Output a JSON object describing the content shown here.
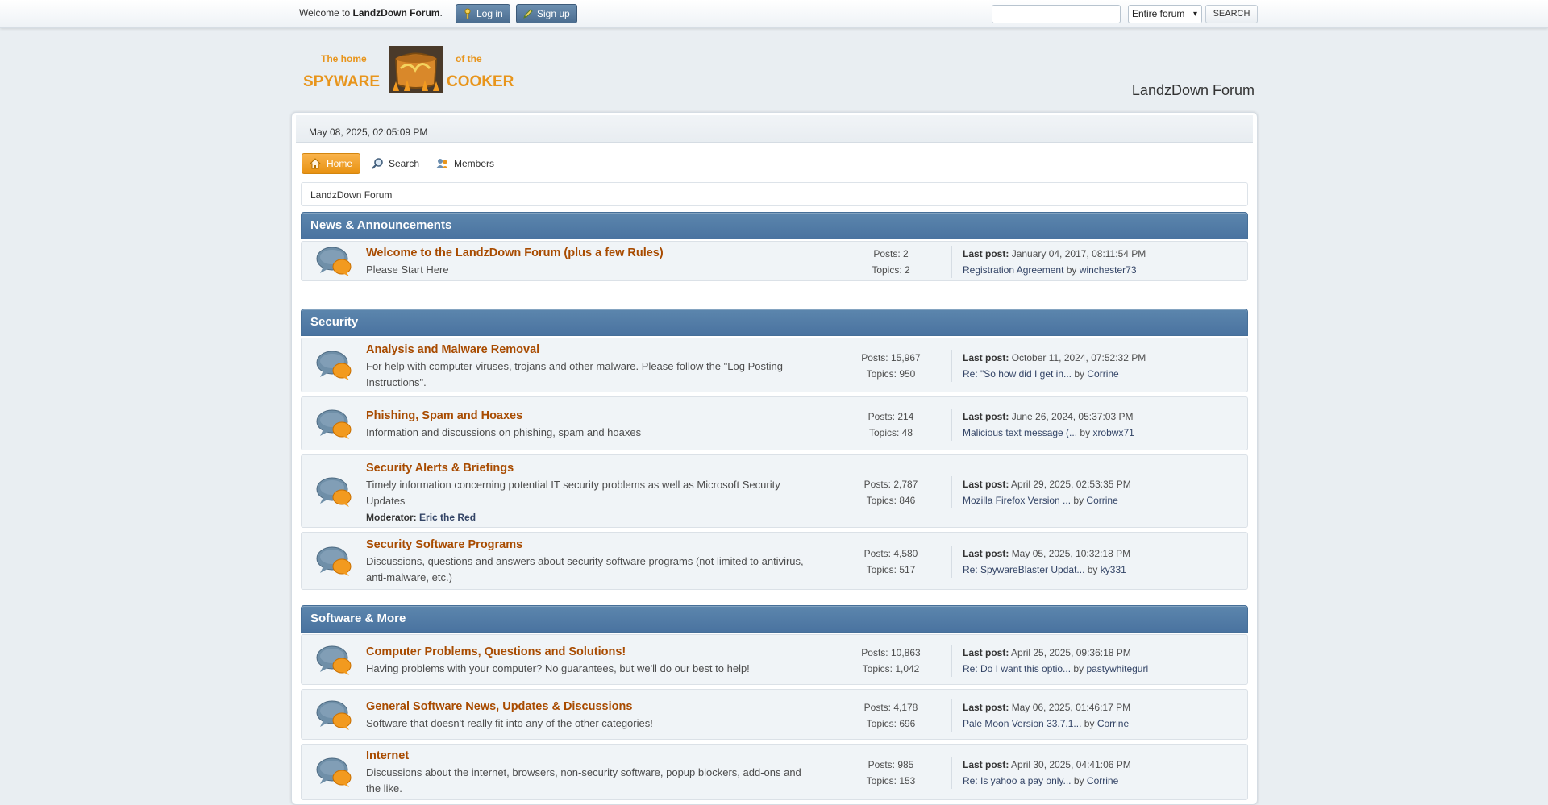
{
  "top_bar": {
    "welcome_prefix": "Welcome to",
    "welcome_forum": "LandzDown Forum",
    "welcome_suffix": ".",
    "login_label": "Log in",
    "signup_label": "Sign up",
    "search_value": "",
    "search_scope": "Entire forum",
    "search_button": "SEARCH"
  },
  "header": {
    "logo_line1_left": "The home",
    "logo_line1_right": "of the",
    "logo_line2_left": "SPYWARE",
    "logo_line2_right": "COOKER",
    "forum_title": "LandzDown Forum"
  },
  "upper": {
    "datetime": "May 08, 2025, 02:05:09 PM"
  },
  "menu": {
    "home": "Home",
    "search": "Search",
    "members": "Members"
  },
  "breadcrumb": "LandzDown Forum",
  "labels": {
    "last_post": "Last post:",
    "by": "by",
    "moderator": "Moderator:"
  },
  "categories": [
    {
      "title": "News & Announcements",
      "boards": [
        {
          "name": "Welcome to the LandzDown Forum (plus a few Rules)",
          "desc": "Please Start Here",
          "posts": "Posts: 2",
          "topics": "Topics: 2",
          "last_date": "January 04, 2017, 08:11:54 PM",
          "last_subject": "Registration Agreement",
          "last_user": "winchester73"
        }
      ]
    },
    {
      "title": "Security",
      "boards": [
        {
          "name": "Analysis and Malware Removal",
          "desc": "For help with computer viruses, trojans and other malware.  Please follow the \"Log Posting Instructions\".",
          "posts": "Posts: 15,967",
          "topics": "Topics: 950",
          "last_date": "October 11, 2024, 07:52:32 PM",
          "last_subject": "Re: \"So how did I get in...",
          "last_user": "Corrine"
        },
        {
          "name": "Phishing, Spam and Hoaxes",
          "desc": "Information and discussions on phishing, spam and hoaxes",
          "posts": "Posts: 214",
          "topics": "Topics: 48",
          "last_date": "June 26, 2024, 05:37:03 PM",
          "last_subject": "Malicious text message (...",
          "last_user": "xrobwx71"
        },
        {
          "name": "Security Alerts & Briefings",
          "desc": "Timely information concerning potential IT security problems as well as Microsoft Security Updates",
          "moderator": "Eric the Red",
          "posts": "Posts: 2,787",
          "topics": "Topics: 846",
          "last_date": "April 29, 2025, 02:53:35 PM",
          "last_subject": "Mozilla Firefox Version ...",
          "last_user": "Corrine"
        },
        {
          "name": "Security Software Programs",
          "desc": "Discussions, questions and answers about security software programs (not limited to antivirus, anti-malware, etc.)",
          "posts": "Posts: 4,580",
          "topics": "Topics: 517",
          "last_date": "May 05, 2025, 10:32:18 PM",
          "last_subject": "Re: SpywareBlaster Updat...",
          "last_user": "ky331"
        }
      ]
    },
    {
      "title": "Software & More",
      "boards": [
        {
          "name": "Computer Problems, Questions and Solutions!",
          "desc": "Having problems with your computer?  No guarantees, but we'll do our best to help!",
          "posts": "Posts: 10,863",
          "topics": "Topics: 1,042",
          "last_date": "April 25, 2025, 09:36:18 PM",
          "last_subject": "Re: Do I want this optio...",
          "last_user": "pastywhitegurl"
        },
        {
          "name": "General Software News, Updates & Discussions",
          "desc": "Software that doesn't really fit into any of the other categories!",
          "posts": "Posts: 4,178",
          "topics": "Topics: 696",
          "last_date": "May 06, 2025, 01:46:17 PM",
          "last_subject": "Pale Moon Version 33.7.1...",
          "last_user": "Corrine"
        },
        {
          "name": "Internet",
          "desc": "Discussions about the internet, browsers, non-security software, popup blockers, add-ons and the like.",
          "posts": "Posts: 985",
          "topics": "Topics: 153",
          "last_date": "April 30, 2025, 04:41:06 PM",
          "last_subject": "Re: Is yahoo a pay only...",
          "last_user": "Corrine"
        }
      ]
    }
  ]
}
